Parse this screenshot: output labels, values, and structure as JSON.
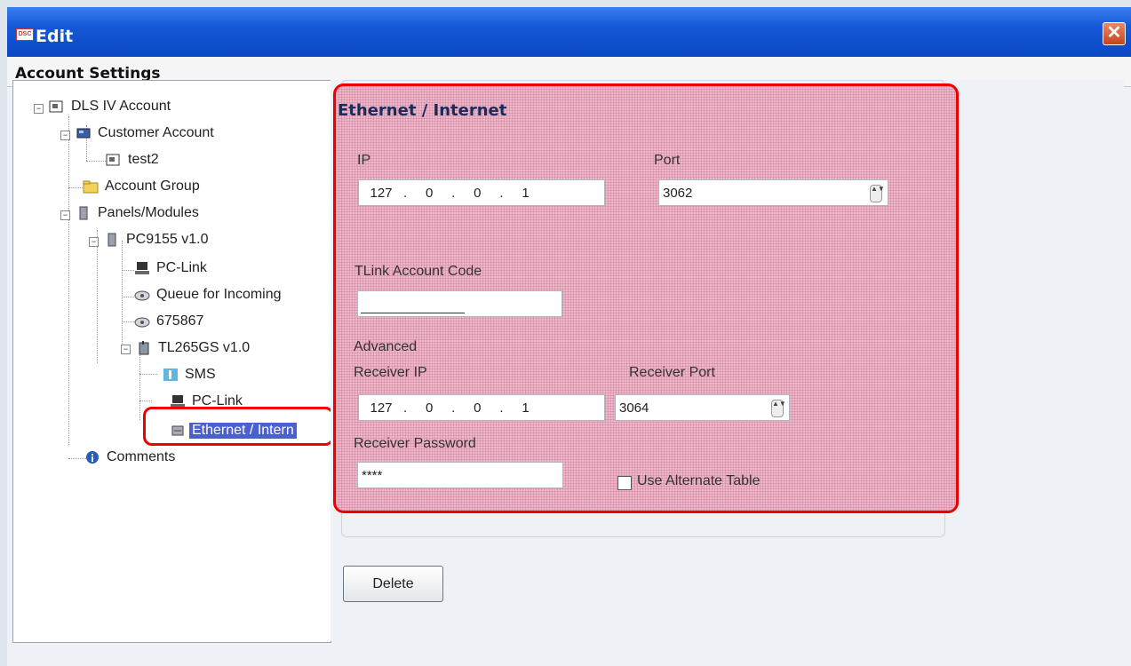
{
  "window": {
    "title": "Edit",
    "app_badge": "DSC",
    "close_glyph": "✕"
  },
  "header": {
    "title": "Account Settings"
  },
  "tree": {
    "root": "DLS IV Account",
    "customer_account": "Customer Account",
    "test2": "test2",
    "account_group": "Account Group",
    "panels_modules": "Panels/Modules",
    "pc9155": "PC9155 v1.0",
    "pc_link": "PC-Link",
    "queue": "Queue for Incoming",
    "num": "675867",
    "tl265gs": "TL265GS v1.0",
    "sms": "SMS",
    "pc_link2": "PC-Link",
    "ethernet": "Ethernet / Intern",
    "comments": "Comments",
    "expand_minus": "−"
  },
  "form": {
    "section_title": "Ethernet / Internet",
    "ip_label": "IP",
    "ip_octets": [
      "127",
      "0",
      "0",
      "1"
    ],
    "port_label": "Port",
    "port_value": "3062",
    "tlink_label": "TLink Account Code",
    "advanced_label": "Advanced",
    "receiver_ip_label": "Receiver IP",
    "receiver_ip_octets": [
      "127",
      "0",
      "0",
      "1"
    ],
    "receiver_port_label": "Receiver Port",
    "receiver_port_value": "3064",
    "receiver_password_label": "Receiver Password",
    "receiver_password_value": "****",
    "alternate_table_label": "Use Alternate Table",
    "spinner_glyph": "▲▼"
  },
  "buttons": {
    "delete": "Delete"
  }
}
